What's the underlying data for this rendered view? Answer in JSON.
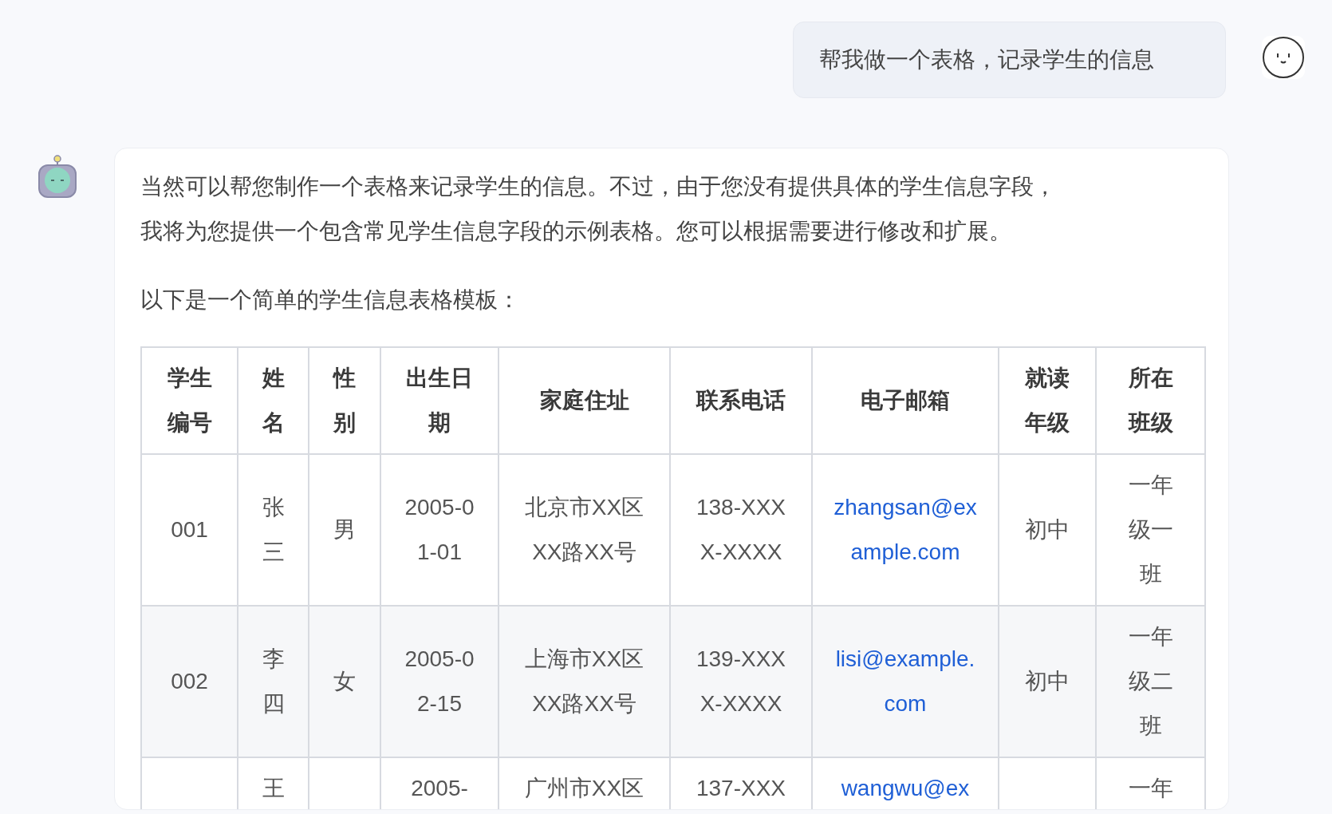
{
  "user_message": {
    "text": "帮我做一个表格，记录学生的信息"
  },
  "assistant_message": {
    "paragraphs": [
      "当然可以帮您制作一个表格来记录学生的信息。不过，由于您没有提供具体的学生信息字段，我将为您提供一个包含常见学生信息字段的示例表格。您可以根据需要进行修改和扩展。",
      "以下是一个简单的学生信息表格模板："
    ],
    "table": {
      "columns": [
        "学生编号",
        "姓名",
        "性别",
        "出生日期",
        "家庭住址",
        "联系电话",
        "电子邮箱",
        "就读年级",
        "所在班级"
      ],
      "rows": [
        {
          "cells": [
            {
              "kind": "text",
              "text": "001"
            },
            {
              "kind": "text",
              "text": "张三"
            },
            {
              "kind": "text",
              "text": "男"
            },
            {
              "kind": "text",
              "text": "2005-01-01"
            },
            {
              "kind": "text",
              "text": "北京市XX区XX路XX号"
            },
            {
              "kind": "text",
              "text": "138-XXXX-XXXX"
            },
            {
              "kind": "link",
              "text": "zhangsan@example.com"
            },
            {
              "kind": "text",
              "text": "初中"
            },
            {
              "kind": "text",
              "text": "一年级一班"
            }
          ]
        },
        {
          "cells": [
            {
              "kind": "text",
              "text": "002"
            },
            {
              "kind": "text",
              "text": "李四"
            },
            {
              "kind": "text",
              "text": "女"
            },
            {
              "kind": "text",
              "text": "2005-02-15"
            },
            {
              "kind": "text",
              "text": "上海市XX区XX路XX号"
            },
            {
              "kind": "text",
              "text": "139-XXXX-XXXX"
            },
            {
              "kind": "link",
              "text": "lisi@example.com"
            },
            {
              "kind": "text",
              "text": "初中"
            },
            {
              "kind": "text",
              "text": "一年级二班"
            }
          ]
        },
        {
          "cells": [
            {
              "kind": "empty"
            },
            {
              "kind": "text",
              "text": "王"
            },
            {
              "kind": "empty"
            },
            {
              "kind": "text",
              "text": "2005-"
            },
            {
              "kind": "text",
              "text": "广州市XX区"
            },
            {
              "kind": "text",
              "text": "137-XXX"
            },
            {
              "kind": "link",
              "text": "wangwu@ex"
            },
            {
              "kind": "empty"
            },
            {
              "kind": "text",
              "text": "一年"
            }
          ]
        }
      ]
    }
  }
}
